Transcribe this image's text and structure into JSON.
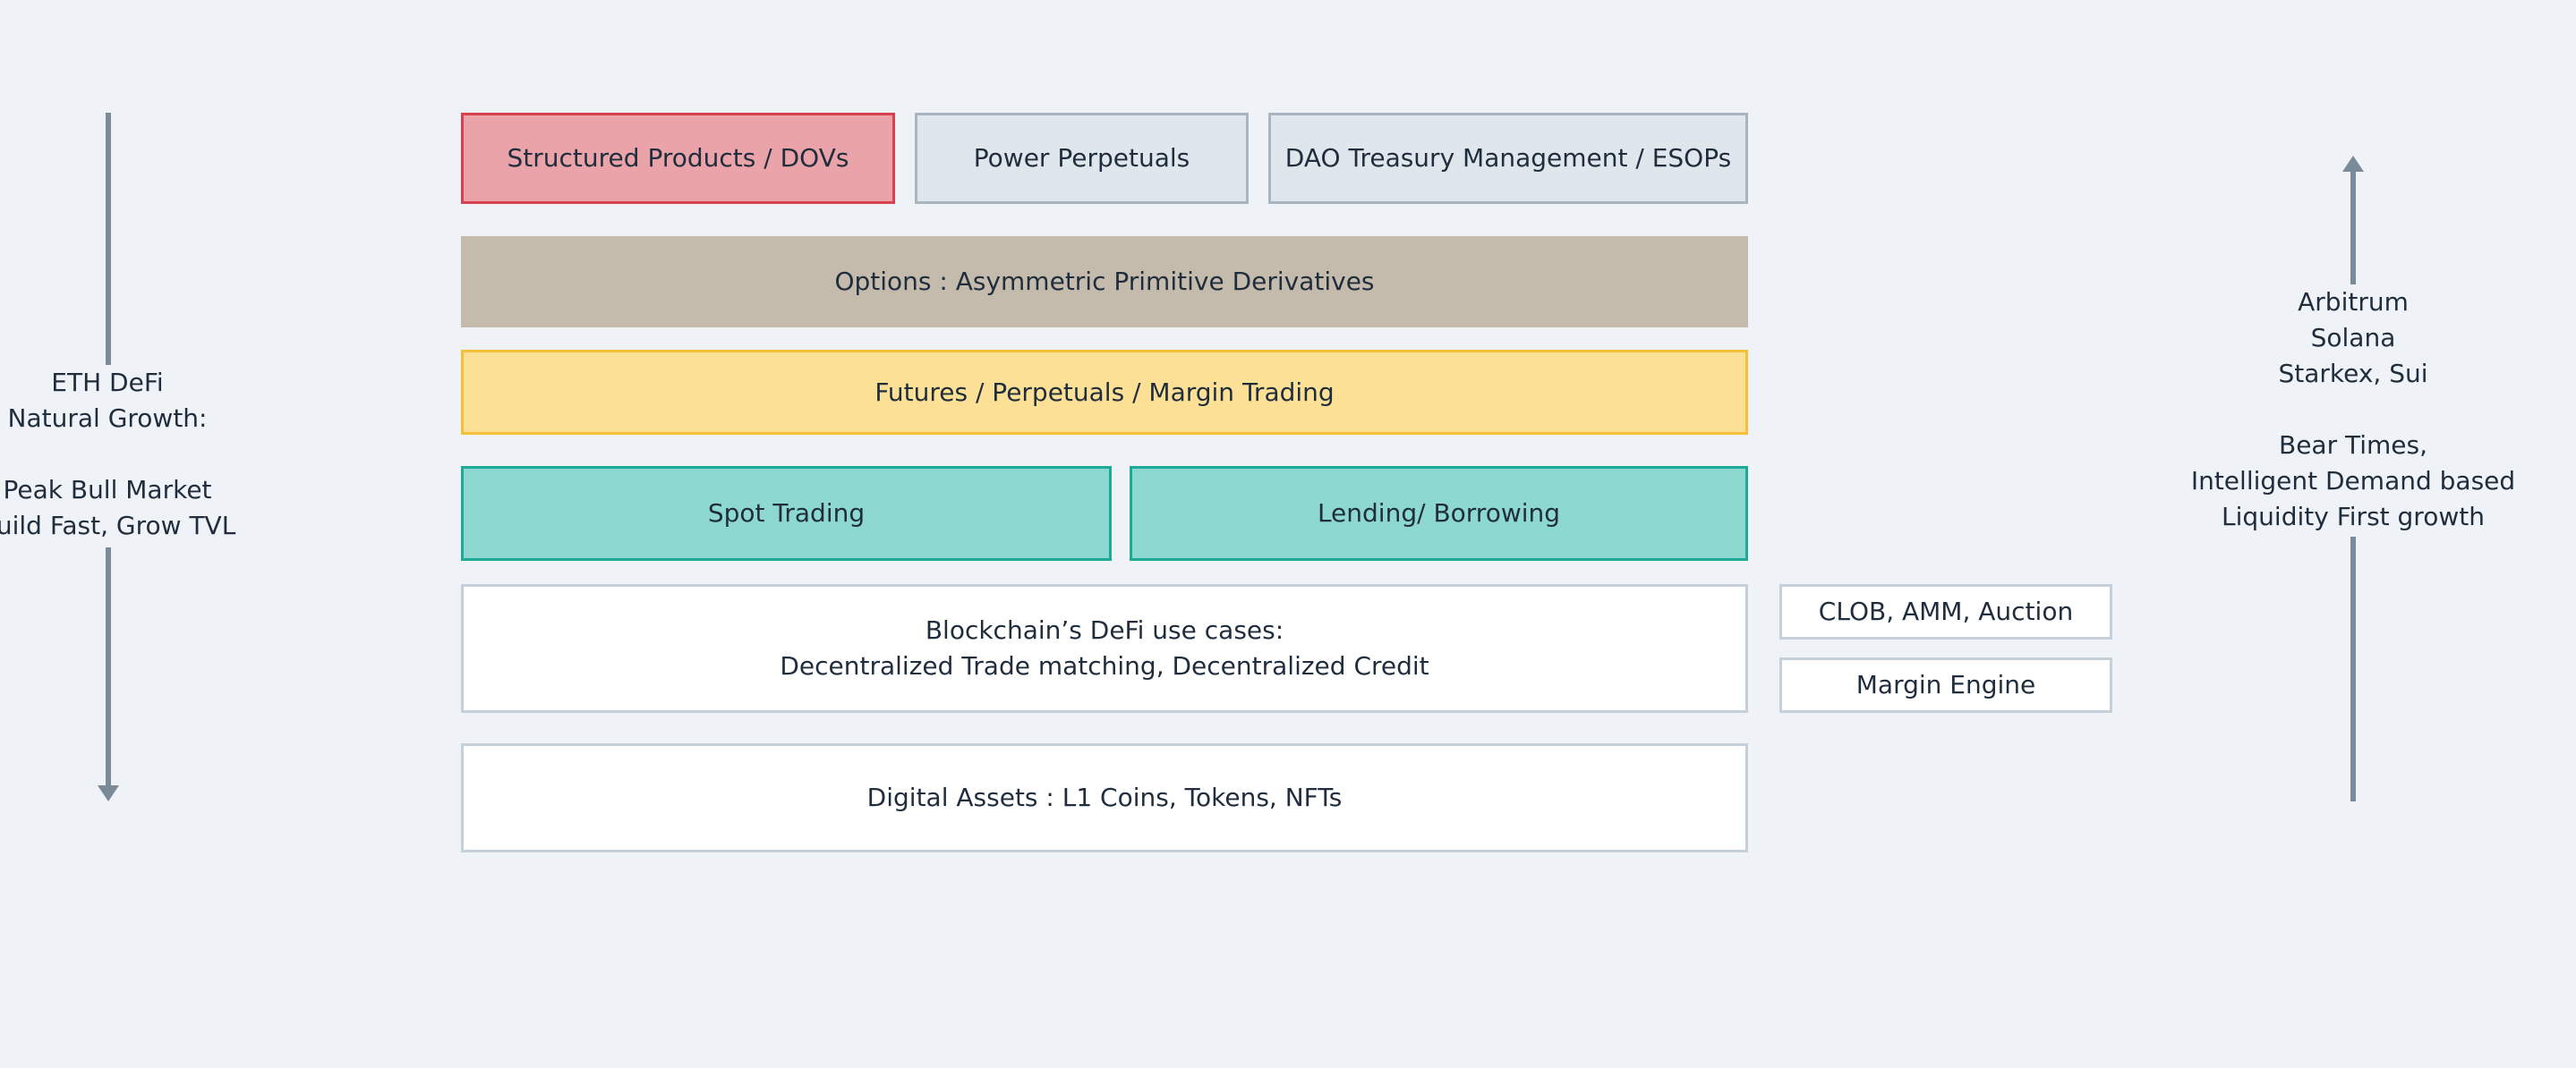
{
  "colors": {
    "background": "#eff3f7",
    "structured_fill": "#eba3aa",
    "structured_border": "#d9414f",
    "neutral_fill": "#dfe6ec",
    "neutral_border": "#a9b5c1",
    "options_fill": "#c4bbad",
    "futures_fill": "#fce095",
    "futures_border": "#f5bf3a",
    "spot_fill": "#8dd8d0",
    "spot_border": "#1daa97",
    "white_fill": "#ffffff",
    "white_border": "#c6d0da",
    "arrow": "#7a8a98"
  },
  "left_label": "ETH DeFi\nNatural Growth:\n\nPeak Bull Market\nBuild Fast, Grow TVL",
  "right_label": "Arbitrum\nSolana\nStarkex, Sui\n\nBear Times,\nIntelligent Demand based\nLiquidity First growth",
  "layers": {
    "structured_products": "Structured Products / DOVs",
    "power_perpetuals": "Power Perpetuals",
    "dao_treasury": "DAO Treasury Management / ESOPs",
    "options": "Options : Asymmetric Primitive Derivatives",
    "futures": "Futures / Perpetuals / Margin Trading",
    "spot_trading": "Spot Trading",
    "lending_borrowing": "Lending/ Borrowing",
    "defi_use_cases": "Blockchain’s DeFi use cases:\nDecentralized Trade matching, Decentralized Credit",
    "digital_assets": "Digital Assets : L1 Coins, Tokens, NFTs"
  },
  "side_boxes": {
    "clob": "CLOB, AMM, Auction",
    "margin_engine": "Margin Engine"
  }
}
